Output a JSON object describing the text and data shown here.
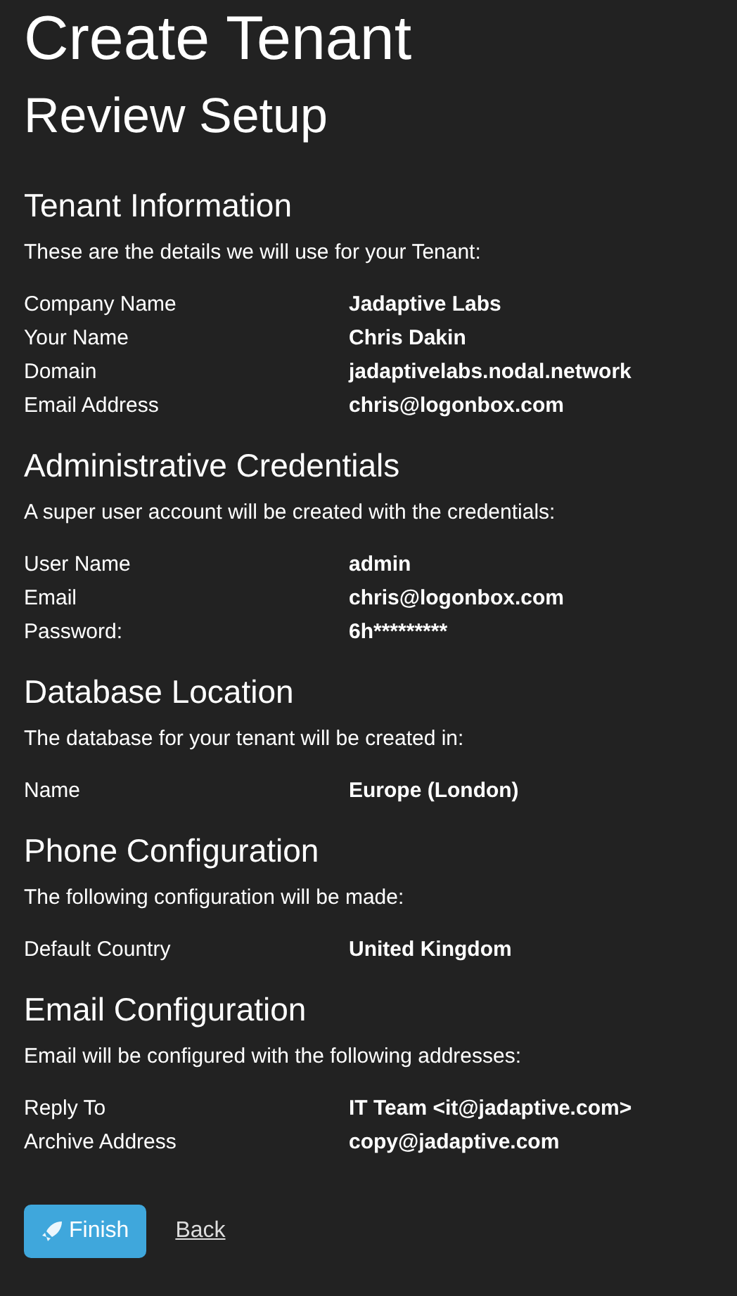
{
  "title": "Create Tenant",
  "subtitle": "Review Setup",
  "sections": [
    {
      "heading": "Tenant Information",
      "description": "These are the details we will use for your Tenant:",
      "rows": [
        {
          "label": "Company Name",
          "value": "Jadaptive Labs"
        },
        {
          "label": "Your Name",
          "value": "Chris Dakin"
        },
        {
          "label": "Domain",
          "value": "jadaptivelabs.nodal.network"
        },
        {
          "label": "Email Address",
          "value": "chris@logonbox.com"
        }
      ]
    },
    {
      "heading": "Administrative Credentials",
      "description": "A super user account will be created with the credentials:",
      "rows": [
        {
          "label": "User Name",
          "value": "admin"
        },
        {
          "label": "Email",
          "value": "chris@logonbox.com"
        },
        {
          "label": "Password:",
          "value": "6h*********"
        }
      ]
    },
    {
      "heading": "Database Location",
      "description": "The database for your tenant will be created in:",
      "rows": [
        {
          "label": "Name",
          "value": "Europe (London)"
        }
      ]
    },
    {
      "heading": "Phone Configuration",
      "description": "The following configuration will be made:",
      "rows": [
        {
          "label": "Default Country",
          "value": "United Kingdom"
        }
      ]
    },
    {
      "heading": "Email Configuration",
      "description": "Email will be configured with the following addresses:",
      "rows": [
        {
          "label": "Reply To",
          "value": "IT Team <it@jadaptive.com>"
        },
        {
          "label": "Archive Address",
          "value": "copy@jadaptive.com"
        }
      ]
    }
  ],
  "buttons": {
    "finish": "Finish",
    "back": "Back"
  }
}
